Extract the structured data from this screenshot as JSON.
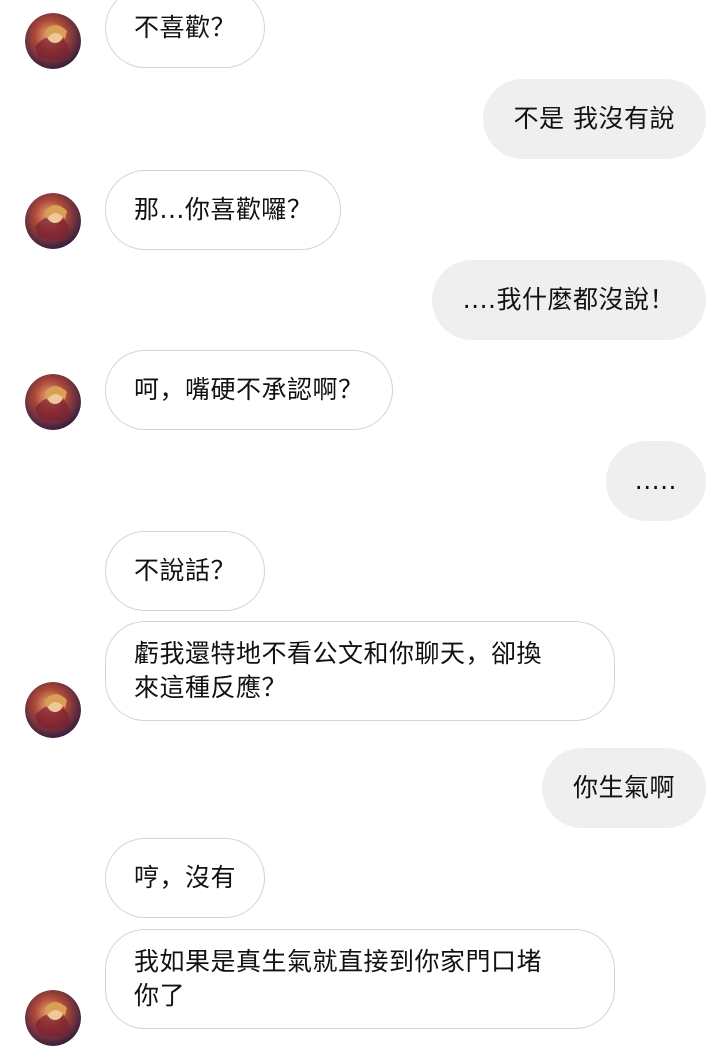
{
  "conversation": {
    "messages": [
      {
        "sender": "contact",
        "text": "不喜歡？"
      },
      {
        "sender": "me",
        "text": "不是 我沒有說"
      },
      {
        "sender": "contact",
        "text": "那...你喜歡囉？"
      },
      {
        "sender": "me",
        "text": "....我什麼都沒說！"
      },
      {
        "sender": "contact",
        "text": "呵，嘴硬不承認啊？"
      },
      {
        "sender": "me",
        "text": "....."
      },
      {
        "sender": "contact",
        "text": "不說話？"
      },
      {
        "sender": "contact",
        "lines": [
          "虧我還特地不看公文和你聊天，卻換",
          "來這種反應？"
        ]
      },
      {
        "sender": "me",
        "text": "你生氣啊"
      },
      {
        "sender": "contact",
        "text": "哼，沒有"
      },
      {
        "sender": "contact",
        "lines": [
          "我如果是真生氣就直接到你家門口堵",
          "你了"
        ]
      }
    ]
  },
  "colors": {
    "incoming_bubble_bg": "#ffffff",
    "incoming_bubble_border": "#d4d4d4",
    "outgoing_bubble_bg": "#efefef",
    "text": "#111111"
  },
  "icons": {
    "contact_avatar": "contact-avatar-icon"
  }
}
